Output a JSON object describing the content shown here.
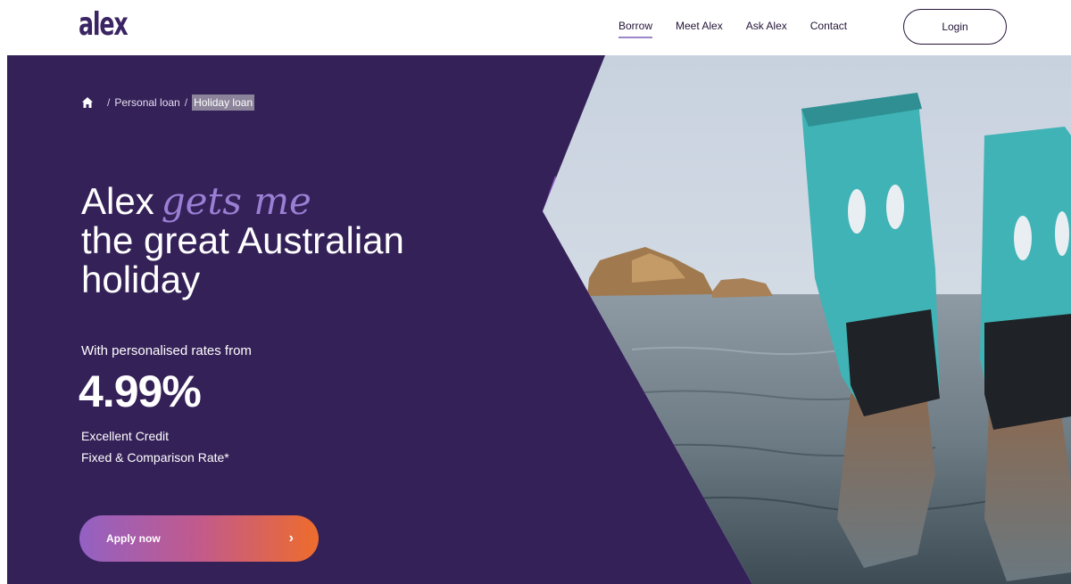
{
  "brand": {
    "logo": "alex"
  },
  "nav": {
    "items": [
      {
        "label": "Borrow",
        "active": true
      },
      {
        "label": "Meet Alex",
        "active": false
      },
      {
        "label": "Ask Alex",
        "active": false
      },
      {
        "label": "Contact",
        "active": false
      }
    ],
    "login_label": "Login"
  },
  "breadcrumb": {
    "home_icon": "home-icon",
    "separator": "/",
    "items": [
      "Personal loan",
      "Holiday loan"
    ]
  },
  "hero": {
    "headline_prefix": "Alex",
    "headline_accent": "gets me",
    "headline_line2": "the great Australian",
    "headline_line3": "holiday",
    "subtext": "With personalised rates from",
    "rate": "4.99%",
    "rate_note_line1": "Excellent Credit",
    "rate_note_line2": "Fixed & Comparison Rate*",
    "cta_label": "Apply now",
    "cta_icon": "chevron-right-icon"
  },
  "colors": {
    "brand_purple": "#342158",
    "accent_lilac": "#9a7fd4",
    "stripe_purple": "#8a5bbf",
    "cta_gradient_start": "#9361c3",
    "cta_gradient_end": "#ee6c2c",
    "fin_teal": "#3fb3b5"
  }
}
